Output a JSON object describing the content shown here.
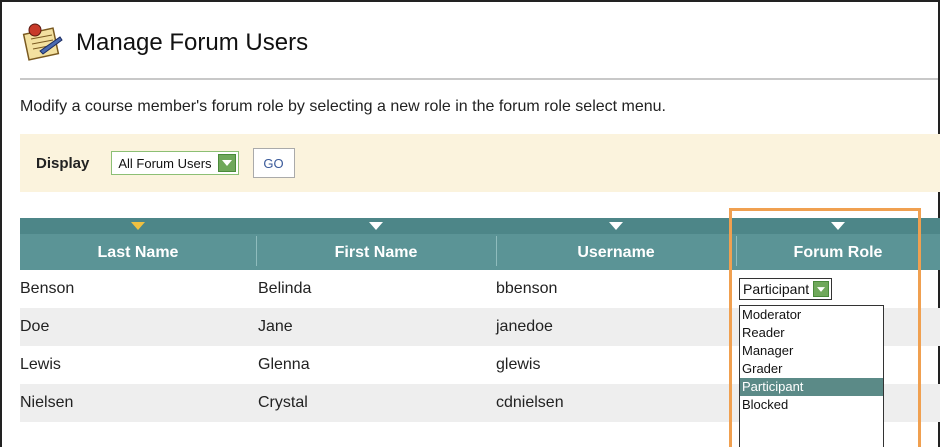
{
  "page": {
    "title": "Manage Forum Users",
    "instructions": "Modify a course member's forum role by selecting a new role in the forum role select menu."
  },
  "display_bar": {
    "label": "Display",
    "selected_value": "All Forum Users",
    "go_label": "GO"
  },
  "table": {
    "columns": [
      "Last Name",
      "First Name",
      "Username",
      "Forum Role"
    ],
    "rows": [
      {
        "last": "Benson",
        "first": "Belinda",
        "username": "bbenson",
        "role": "Participant"
      },
      {
        "last": "Doe",
        "first": "Jane",
        "username": "janedoe",
        "role": ""
      },
      {
        "last": "Lewis",
        "first": "Glenna",
        "username": "glewis",
        "role": ""
      },
      {
        "last": "Nielsen",
        "first": "Crystal",
        "username": "cdnielsen",
        "role": ""
      }
    ]
  },
  "role_dropdown": {
    "options": [
      "Moderator",
      "Reader",
      "Manager",
      "Grader",
      "Participant",
      "Blocked"
    ],
    "selected": "Participant"
  },
  "colors": {
    "header_teal": "#5b9496",
    "sort_arrow": "#f0c040",
    "highlight": "#f0a050",
    "display_bar_bg": "#fbf3dd"
  },
  "icons": {
    "header": "forum-users-icon",
    "sort": "triangle-down-icon",
    "dropdown": "chevron-down-icon"
  }
}
